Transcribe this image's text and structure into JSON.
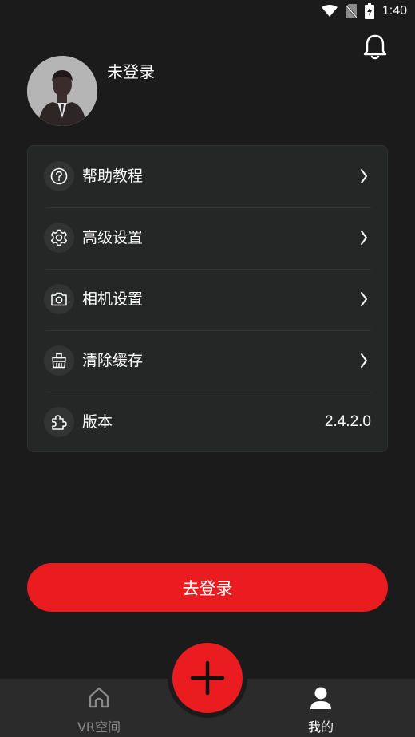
{
  "status_bar": {
    "time": "1:40",
    "icons": [
      "wifi-icon",
      "no-sim-icon",
      "battery-charging-icon"
    ]
  },
  "header": {
    "username": "未登录",
    "notification_icon": "bell-icon",
    "avatar_icon": "default-avatar"
  },
  "menu": {
    "items": [
      {
        "label": "帮助教程",
        "icon": "help-icon"
      },
      {
        "label": "高级设置",
        "icon": "gear-icon"
      },
      {
        "label": "相机设置",
        "icon": "camera-icon"
      },
      {
        "label": "清除缓存",
        "icon": "clear-cache-icon"
      },
      {
        "label": "版本",
        "icon": "puzzle-icon",
        "value": "2.4.2.0"
      }
    ]
  },
  "login_button": {
    "label": "去登录"
  },
  "tab_bar": {
    "tabs": [
      {
        "label": "VR空间",
        "icon": "home-icon",
        "active": false
      },
      {
        "label": "我的",
        "icon": "person-icon",
        "active": true
      }
    ],
    "fab_icon": "plus-icon"
  },
  "colors": {
    "accent": "#ea1c1f",
    "background": "#1b1b1b",
    "card": "#252626",
    "tab_bar": "#2b2b2b"
  }
}
